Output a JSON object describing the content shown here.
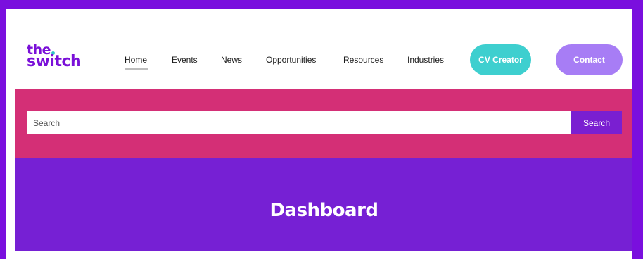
{
  "colors": {
    "outer_background": "#7a0fde",
    "brand_purple": "#7a10d8",
    "search_band": "#d42f76",
    "hero_background": "#7620d4",
    "cv_button": "#3ecfcf",
    "contact_button": "#a77df5",
    "search_button": "#7a1fd1",
    "logo_dot": "#2ec4c9"
  },
  "logo": {
    "line1": "the",
    "line2": "switch"
  },
  "nav": {
    "items": [
      {
        "label": "Home",
        "active": true
      },
      {
        "label": "Events",
        "active": false
      },
      {
        "label": "News",
        "active": false
      },
      {
        "label": "Opportunities",
        "active": false
      },
      {
        "label": "Resources",
        "active": false
      },
      {
        "label": "Industries",
        "active": false
      }
    ]
  },
  "actions": {
    "cv_creator": "CV Creator",
    "contact": "Contact"
  },
  "search": {
    "placeholder": "Search",
    "button_label": "Search"
  },
  "hero": {
    "title": "Dashboard"
  }
}
